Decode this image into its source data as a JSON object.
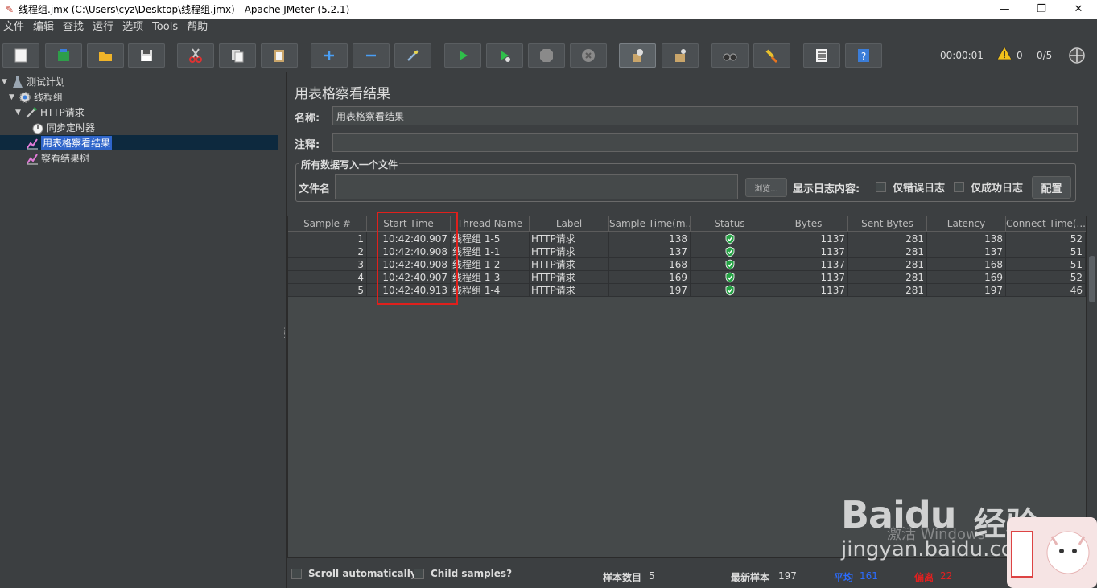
{
  "window": {
    "title": "线程组.jmx (C:\\Users\\cyz\\Desktop\\线程组.jmx) - Apache JMeter (5.2.1)",
    "minimize": "—",
    "maximize": "❐",
    "close": "✕"
  },
  "menu": [
    "文件",
    "编辑",
    "查找",
    "运行",
    "选项",
    "Tools",
    "帮助"
  ],
  "toolbar": {
    "timer": "00:00:01",
    "warnings": "0",
    "threads": "0/5"
  },
  "tree": {
    "items": [
      {
        "label": "测试计划",
        "icon": "test-plan-icon"
      },
      {
        "label": "线程组",
        "icon": "gear-icon"
      },
      {
        "label": "HTTP请求",
        "icon": "pipette-icon"
      },
      {
        "label": "同步定时器",
        "icon": "stopwatch-icon"
      },
      {
        "label": "用表格察看结果",
        "icon": "chart-icon"
      },
      {
        "label": "察看结果树",
        "icon": "chart-icon"
      }
    ]
  },
  "panel": {
    "title": "用表格察看结果",
    "name_label": "名称:",
    "name_value": "用表格察看结果",
    "comment_label": "注释:",
    "comment_value": "",
    "file_group_legend": "所有数据写入一个文件",
    "file_label": "文件名",
    "file_value": "",
    "browse_button": "浏览...",
    "log_display_label": "显示日志内容:",
    "errors_only": "仅错误日志",
    "success_only": "仅成功日志",
    "configure_button": "配置"
  },
  "table": {
    "columns": [
      "Sample #",
      "Start Time",
      "Thread Name",
      "Label",
      "Sample Time(m...",
      "Status",
      "Bytes",
      "Sent Bytes",
      "Latency",
      "Connect Time(..."
    ],
    "rows": [
      [
        "1",
        "10:42:40.907",
        "线程组 1-5",
        "HTTP请求",
        "138",
        "success",
        "1137",
        "281",
        "138",
        "52"
      ],
      [
        "2",
        "10:42:40.908",
        "线程组 1-1",
        "HTTP请求",
        "137",
        "success",
        "1137",
        "281",
        "137",
        "51"
      ],
      [
        "3",
        "10:42:40.908",
        "线程组 1-2",
        "HTTP请求",
        "168",
        "success",
        "1137",
        "281",
        "168",
        "51"
      ],
      [
        "4",
        "10:42:40.907",
        "线程组 1-3",
        "HTTP请求",
        "169",
        "success",
        "1137",
        "281",
        "169",
        "52"
      ],
      [
        "5",
        "10:42:40.913",
        "线程组 1-4",
        "HTTP请求",
        "197",
        "success",
        "1137",
        "281",
        "197",
        "46"
      ]
    ]
  },
  "bottom": {
    "scroll_auto": "Scroll automatically?",
    "child_samples": "Child samples?",
    "sample_count_label": "样本数目",
    "sample_count": "5",
    "latest_label": "最新样本",
    "latest": "197",
    "avg_label": "平均",
    "avg": "161",
    "dev_label": "偏离",
    "dev": "22"
  },
  "watermark": {
    "logo": "Bai",
    "logo_du": "du",
    "cn": "经验",
    "url": "jingyan.baidu.com",
    "activate": "激活 Windows"
  },
  "colors": {
    "highlight_box": "#e0201c",
    "status_ok": "#25a244",
    "avg_value": "#2b6cff",
    "dev_value": "#e02020"
  }
}
